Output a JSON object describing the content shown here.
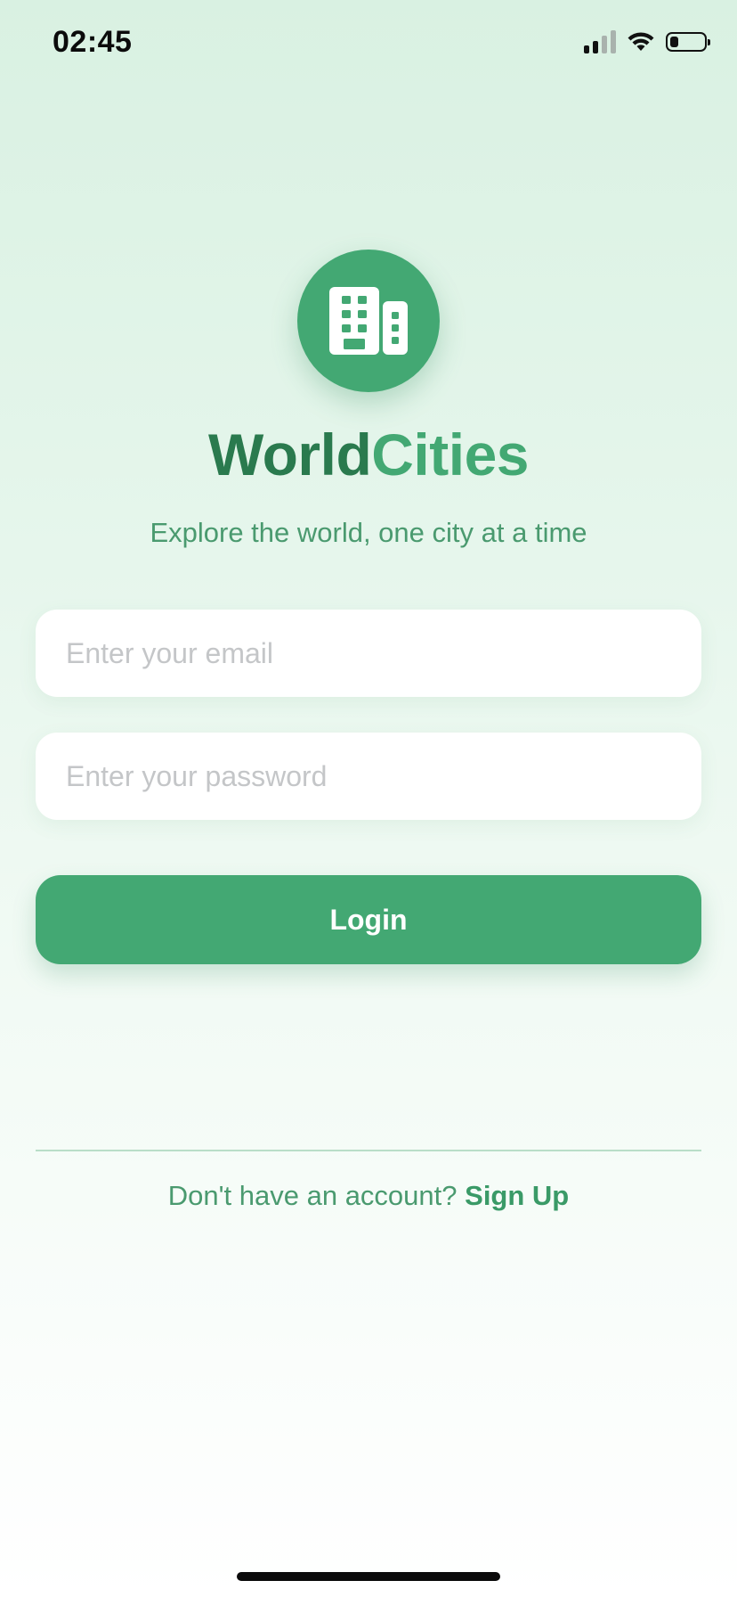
{
  "status_bar": {
    "time": "02:45",
    "battery_level": 0.25
  },
  "app": {
    "logo_icon": "building-icon",
    "title_part1": "World",
    "title_part2": "Cities",
    "tagline": "Explore the world, one city at a time"
  },
  "form": {
    "email_placeholder": "Enter your email",
    "email_value": "",
    "password_placeholder": "Enter your password",
    "password_value": "",
    "login_label": "Login"
  },
  "footer": {
    "prompt": "Don't have an account?",
    "signup_label": "Sign Up"
  },
  "colors": {
    "brand_green": "#43a873",
    "title_dark_green": "#2a7a4e",
    "text_green": "#4a9a6f"
  }
}
